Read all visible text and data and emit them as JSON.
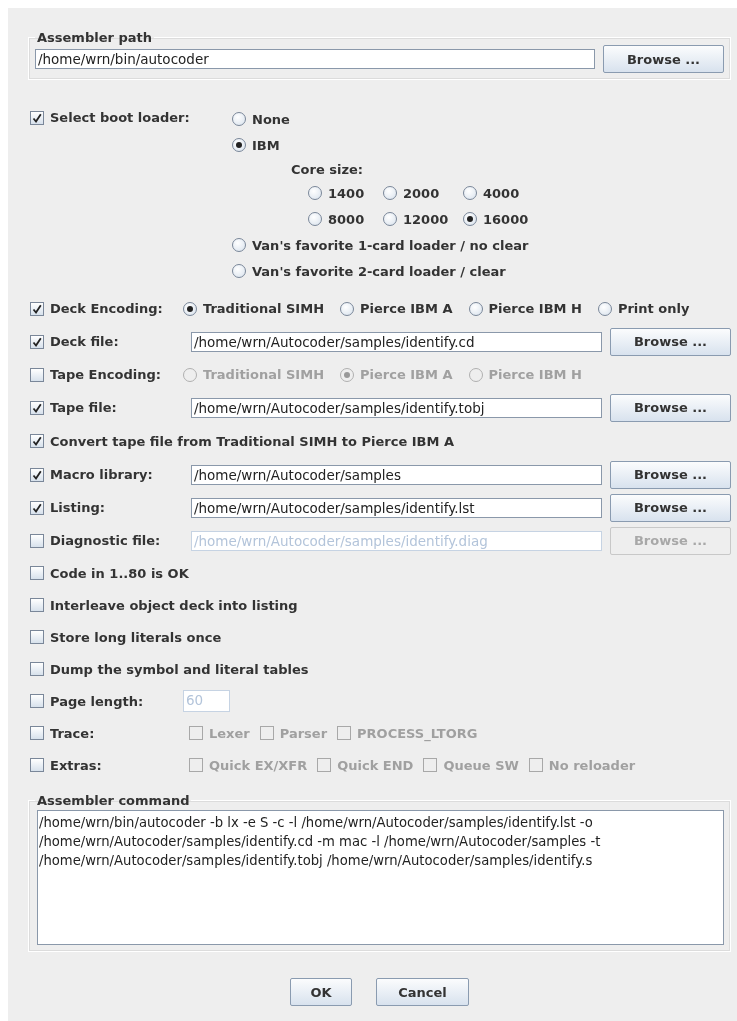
{
  "assembler_path": {
    "title": "Assembler path",
    "value": "/home/wrn/bin/autocoder",
    "button": "Browse ..."
  },
  "boot_loader": {
    "checked": true,
    "label": "Select boot loader:",
    "options": [
      {
        "label": "None",
        "selected": false
      },
      {
        "label": "IBM",
        "selected": true,
        "core_size": {
          "label": "Core size:",
          "sizes": [
            {
              "label": "1400",
              "selected": false
            },
            {
              "label": "2000",
              "selected": false
            },
            {
              "label": "4000",
              "selected": false
            },
            {
              "label": "8000",
              "selected": false
            },
            {
              "label": "12000",
              "selected": false
            },
            {
              "label": "16000",
              "selected": true
            }
          ]
        }
      },
      {
        "label": "Van's favorite 1-card loader / no clear",
        "selected": false
      },
      {
        "label": "Van's favorite 2-card loader / clear",
        "selected": false
      }
    ]
  },
  "rows": [
    {
      "kind": "radios",
      "checked": true,
      "label": "Deck Encoding:",
      "disabled": false,
      "options": [
        {
          "label": "Traditional SIMH",
          "selected": true
        },
        {
          "label": "Pierce IBM A",
          "selected": false
        },
        {
          "label": "Pierce IBM H",
          "selected": false
        },
        {
          "label": "Print only",
          "selected": false
        }
      ]
    },
    {
      "kind": "file",
      "checked": true,
      "label": "Deck file:",
      "value": "/home/wrn/Autocoder/samples/identify.cd",
      "button": "Browse ...",
      "disabled": false
    },
    {
      "kind": "radios",
      "checked": false,
      "label": "Tape Encoding:",
      "disabled": true,
      "options": [
        {
          "label": "Traditional SIMH",
          "selected": false
        },
        {
          "label": "Pierce IBM A",
          "selected": true
        },
        {
          "label": "Pierce IBM H",
          "selected": false
        }
      ]
    },
    {
      "kind": "file",
      "checked": true,
      "label": "Tape file:",
      "value": "/home/wrn/Autocoder/samples/identify.tobj",
      "button": "Browse ...",
      "disabled": false
    },
    {
      "kind": "check",
      "checked": true,
      "label": "Convert tape file from Traditional SIMH to Pierce IBM A"
    },
    {
      "kind": "file",
      "checked": true,
      "label": "Macro library:",
      "value": "/home/wrn/Autocoder/samples",
      "button": "Browse ...",
      "disabled": false
    },
    {
      "kind": "file",
      "checked": true,
      "label": "Listing:",
      "value": "/home/wrn/Autocoder/samples/identify.lst",
      "button": "Browse ...",
      "disabled": false
    },
    {
      "kind": "file",
      "checked": false,
      "label": "Diagnostic file:",
      "value": "/home/wrn/Autocoder/samples/identify.diag",
      "button": "Browse ...",
      "disabled": true
    },
    {
      "kind": "check",
      "checked": false,
      "label": "Code in 1..80 is OK"
    },
    {
      "kind": "check",
      "checked": false,
      "label": "Interleave object deck into listing"
    },
    {
      "kind": "check",
      "checked": false,
      "label": "Store long literals once"
    },
    {
      "kind": "check",
      "checked": false,
      "label": "Dump the symbol and literal tables"
    },
    {
      "kind": "number",
      "checked": false,
      "label": "Page length:",
      "value": "60",
      "disabled": true
    },
    {
      "kind": "checks",
      "checked": false,
      "label": "Trace:",
      "disabled": true,
      "options": [
        {
          "label": "Lexer",
          "checked": false
        },
        {
          "label": "Parser",
          "checked": false
        },
        {
          "label": "PROCESS_LTORG",
          "checked": false
        }
      ]
    },
    {
      "kind": "checks",
      "checked": false,
      "label": "Extras:",
      "disabled": true,
      "options": [
        {
          "label": "Quick EX/XFR",
          "checked": false
        },
        {
          "label": "Quick END",
          "checked": false
        },
        {
          "label": "Queue SW",
          "checked": false
        },
        {
          "label": "No reloader",
          "checked": false
        }
      ]
    }
  ],
  "assembler_command": {
    "title": "Assembler command",
    "lines": [
      "/home/wrn/bin/autocoder -b lx -e S -c -l /home/wrn/Autocoder/samples/identify.lst -o",
      "/home/wrn/Autocoder/samples/identify.cd -m mac -l /home/wrn/Autocoder/samples -t",
      "/home/wrn/Autocoder/samples/identify.tobj /home/wrn/Autocoder/samples/identify.s"
    ]
  },
  "buttons": [
    "OK",
    "Cancel"
  ]
}
